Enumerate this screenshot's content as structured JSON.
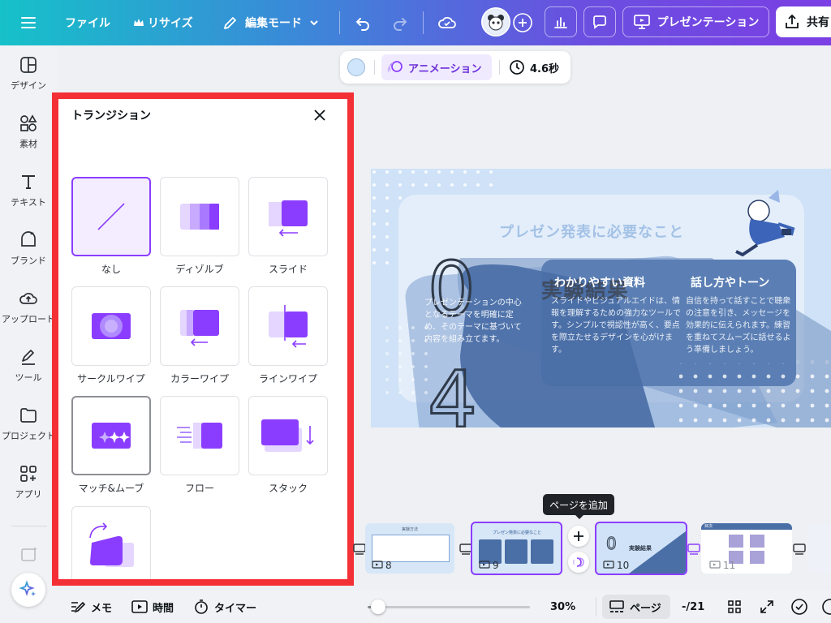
{
  "topbar": {
    "file_label": "ファイル",
    "resize_label": "リサイズ",
    "edit_mode_label": "編集モード",
    "present_label": "プレゼンテーション",
    "share_label": "共有",
    "colors": {
      "gradient_start": "#16c1c9",
      "gradient_end": "#7b3fe4"
    }
  },
  "sidebar": {
    "items": [
      {
        "label": "デザイン",
        "icon": "design-icon"
      },
      {
        "label": "素材",
        "icon": "elements-icon"
      },
      {
        "label": "テキスト",
        "icon": "text-icon"
      },
      {
        "label": "ブランド",
        "icon": "brand-icon"
      },
      {
        "label": "アップロード",
        "icon": "upload-icon"
      },
      {
        "label": "ツール",
        "icon": "tools-icon"
      },
      {
        "label": "プロジェクト",
        "icon": "folder-icon"
      },
      {
        "label": "アプリ",
        "icon": "apps-icon"
      }
    ]
  },
  "panel": {
    "title": "トランジション",
    "tiles": [
      {
        "label": "なし",
        "state": "selected"
      },
      {
        "label": "ディゾルブ",
        "state": ""
      },
      {
        "label": "スライド",
        "state": ""
      },
      {
        "label": "サークルワイプ",
        "state": ""
      },
      {
        "label": "カラーワイプ",
        "state": ""
      },
      {
        "label": "ラインワイプ",
        "state": ""
      },
      {
        "label": "マッチ&ムーブ",
        "state": "hovered"
      },
      {
        "label": "フロー",
        "state": ""
      },
      {
        "label": "スタック",
        "state": ""
      },
      {
        "label": "",
        "state": ""
      }
    ],
    "accent": "#8b3dff",
    "highlight_frame": "#f33036"
  },
  "context_bar": {
    "animation_label": "アニメーション",
    "duration_label": "4.6秒",
    "color_swatch": "#cfe5fb"
  },
  "slide": {
    "title": "プレゼン発表に必要なこと",
    "big_letters": "実験結果",
    "col1_head": "わかりやすい資料",
    "col1_body": "スライドやビジュアルエイドは、情報を理解するための強力なツールです。シンプルで視認性が高く、要点を際立たせるデザインを心がけます。",
    "col2_head": "話し方やトーン",
    "col2_body": "自信を持って話すことで聴衆の注意を引き、メッセージを効果的に伝えられます。練習を重ねてスムーズに話せるよう準備しましょう。",
    "col0_body": "プレゼンテーションの中心となるテーマを明確に定め、そのテーマに基づいて内容を組み立てます。",
    "num_top": "0",
    "num_bottom": "4"
  },
  "tooltip": {
    "add_page": "ページを追加"
  },
  "thumbnails": [
    {
      "num": "8",
      "title": "実験方法"
    },
    {
      "num": "9",
      "title": "プレゼン発表に必要なこと"
    },
    {
      "num": "10",
      "title": "実験結果"
    },
    {
      "num": "11",
      "title": "目次"
    }
  ],
  "bottombar": {
    "notes_label": "メモ",
    "time_label": "時間",
    "timer_label": "タイマー",
    "zoom_label": "30%",
    "zoom_value": 30,
    "pages_label": "ページ",
    "page_count": "-/21"
  }
}
